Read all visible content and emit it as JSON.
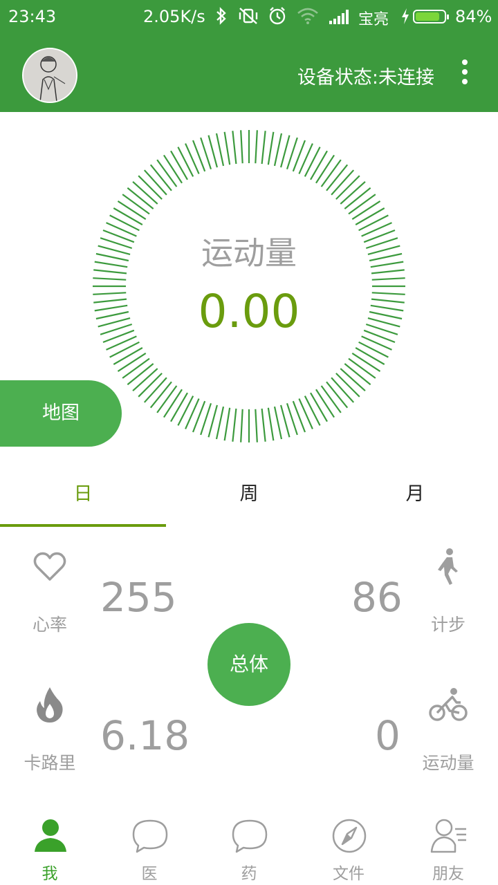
{
  "status_bar": {
    "time": "23:43",
    "net_speed": "2.05K/s",
    "carrier": "宝亮",
    "battery": "84%",
    "battery_level": 0.84
  },
  "app_bar": {
    "device_status": "设备状态:未连接"
  },
  "gauge": {
    "title": "运动量",
    "value": "0.00"
  },
  "map_button": "地图",
  "tabs": [
    {
      "label": "日",
      "active": true
    },
    {
      "label": "周",
      "active": false
    },
    {
      "label": "月",
      "active": false
    }
  ],
  "stats": {
    "heart_rate": {
      "label": "心率",
      "value": "255",
      "icon": "heart-icon"
    },
    "steps": {
      "label": "计步",
      "value": "86",
      "icon": "walking-icon"
    },
    "calories": {
      "label": "卡路里",
      "value": "6.18",
      "icon": "flame-icon"
    },
    "exercise": {
      "label": "运动量",
      "value": "0",
      "icon": "bicycle-icon"
    }
  },
  "total_button": "总体",
  "bottom_nav": [
    {
      "label": "我",
      "icon": "person-icon",
      "active": true
    },
    {
      "label": "医",
      "icon": "chat-bubble-icon",
      "active": false
    },
    {
      "label": "药",
      "icon": "chat-bubble-icon",
      "active": false
    },
    {
      "label": "文件",
      "icon": "compass-icon",
      "active": false
    },
    {
      "label": "朋友",
      "icon": "contacts-icon",
      "active": false
    }
  ],
  "colors": {
    "primary": "#3c9a3d",
    "accent": "#4caf50",
    "value_green": "#6a9c0e",
    "gray": "#9e9e9e"
  }
}
